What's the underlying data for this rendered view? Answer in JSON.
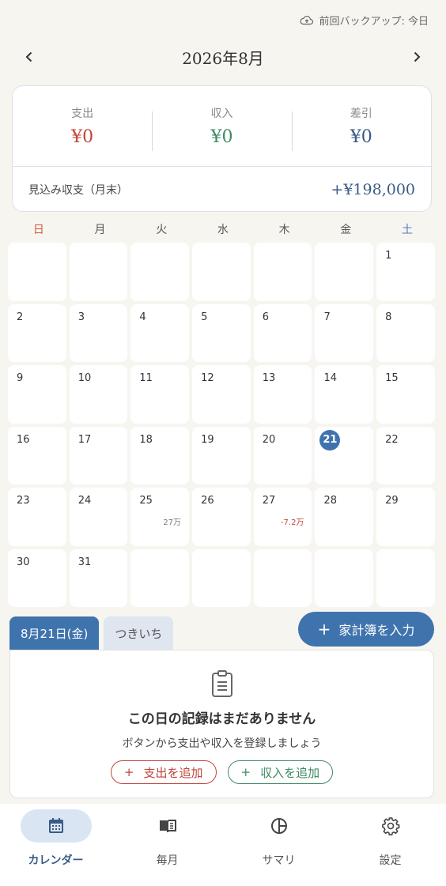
{
  "backup": {
    "text": "前回バックアップ: 今日",
    "icon": "cloud-upload-icon"
  },
  "header": {
    "month_title": "2026年8月"
  },
  "summary": {
    "expense_label": "支出",
    "expense_value": "¥0",
    "income_label": "収入",
    "income_value": "¥0",
    "diff_label": "差引",
    "diff_value": "¥0",
    "projection_label": "見込み収支（月末）",
    "projection_value": "+¥198,000"
  },
  "weekdays": [
    "日",
    "月",
    "火",
    "水",
    "木",
    "金",
    "土"
  ],
  "calendar": {
    "days": [
      {
        "n": ""
      },
      {
        "n": ""
      },
      {
        "n": ""
      },
      {
        "n": ""
      },
      {
        "n": ""
      },
      {
        "n": ""
      },
      {
        "n": "1"
      },
      {
        "n": "2"
      },
      {
        "n": "3"
      },
      {
        "n": "4"
      },
      {
        "n": "5"
      },
      {
        "n": "6"
      },
      {
        "n": "7"
      },
      {
        "n": "8"
      },
      {
        "n": "9"
      },
      {
        "n": "10"
      },
      {
        "n": "11"
      },
      {
        "n": "12"
      },
      {
        "n": "13"
      },
      {
        "n": "14"
      },
      {
        "n": "15"
      },
      {
        "n": "16"
      },
      {
        "n": "17"
      },
      {
        "n": "18"
      },
      {
        "n": "19"
      },
      {
        "n": "20"
      },
      {
        "n": "21",
        "today": true
      },
      {
        "n": "22"
      },
      {
        "n": "23"
      },
      {
        "n": "24"
      },
      {
        "n": "25",
        "amount": "27万"
      },
      {
        "n": "26"
      },
      {
        "n": "27",
        "amount": "-7.2万",
        "neg": true
      },
      {
        "n": "28"
      },
      {
        "n": "29"
      },
      {
        "n": "30"
      },
      {
        "n": "31"
      },
      {
        "n": ""
      },
      {
        "n": ""
      },
      {
        "n": ""
      },
      {
        "n": ""
      },
      {
        "n": ""
      }
    ]
  },
  "tabs": {
    "selected_date": "8月21日(金)",
    "other": "つきいち"
  },
  "add_button": {
    "label": "家計簿を入力",
    "plus": "+"
  },
  "empty_state": {
    "title": "この日の記録はまだありません",
    "subtitle": "ボタンから支出や収入を登録しましょう",
    "add_expense": "支出を追加",
    "add_income": "収入を追加",
    "plus": "+"
  },
  "bottom_nav": {
    "calendar": "カレンダー",
    "monthly": "毎月",
    "summary": "サマリ",
    "settings": "設定"
  },
  "colors": {
    "accent": "#3f73ad",
    "expense": "#c0453b",
    "income": "#3f8a62",
    "diff": "#3a5a85"
  }
}
